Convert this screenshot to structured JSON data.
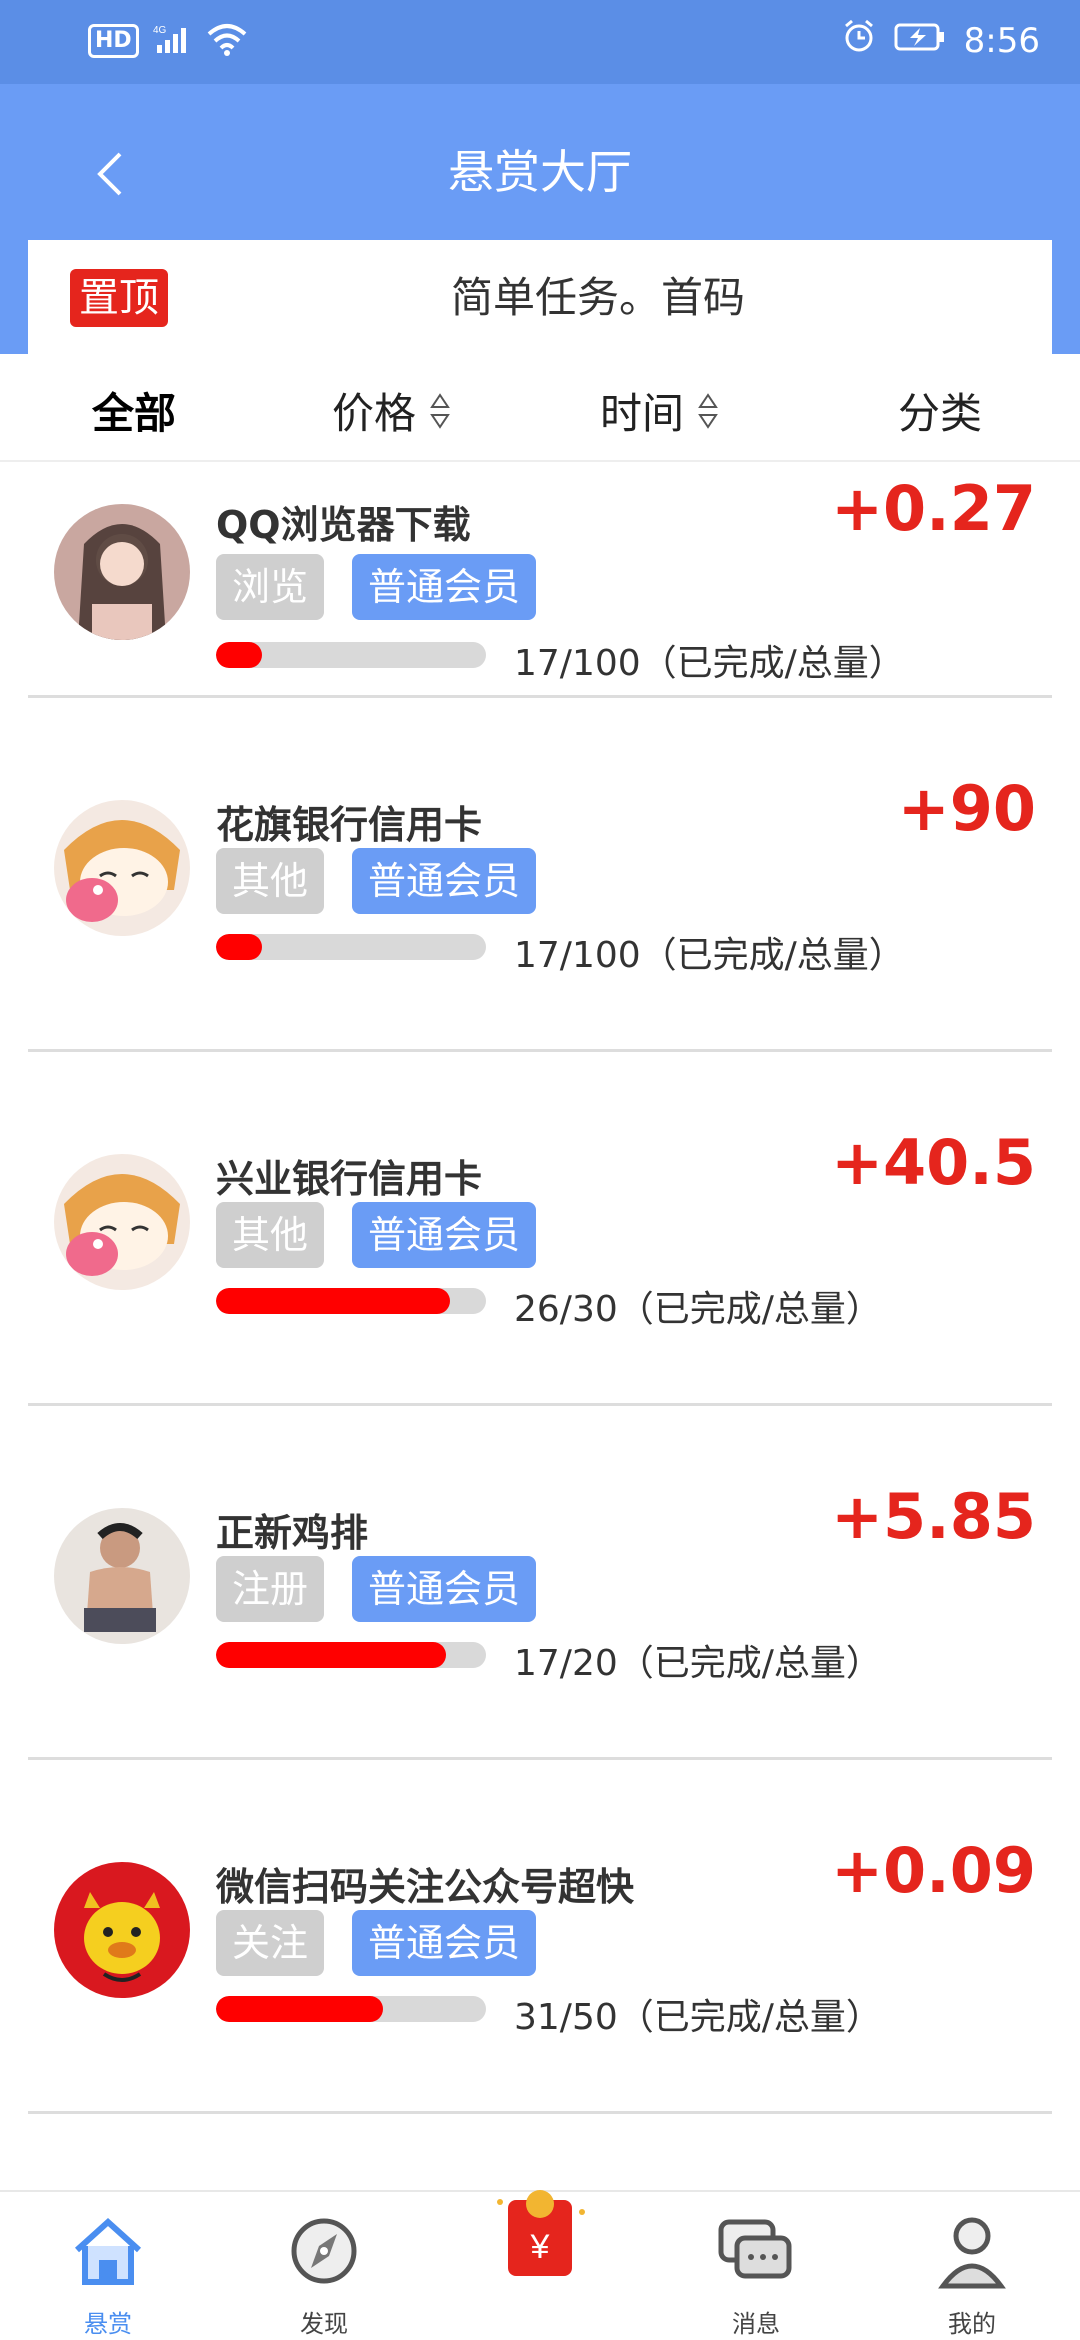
{
  "status_bar": {
    "network": "HD",
    "signal": "4G",
    "time": "8:56"
  },
  "header": {
    "title": "悬赏大厅",
    "back_icon": "chevron-left-icon"
  },
  "banner": {
    "pin_label": "置顶",
    "text": "简单任务。首码"
  },
  "filters": [
    {
      "label": "全部",
      "active": true
    },
    {
      "label": "价格",
      "sortable": true
    },
    {
      "label": "时间",
      "sortable": true
    },
    {
      "label": "分类"
    }
  ],
  "tasks": [
    {
      "title": "QQ浏览器下载",
      "reward": "+0.27",
      "category": "浏览",
      "member": "普通会员",
      "progress_text": "17/100（已完成/总量）",
      "progress": 0.17
    },
    {
      "title": "花旗银行信用卡",
      "reward": "+90",
      "category": "其他",
      "member": "普通会员",
      "progress_text": "17/100（已完成/总量）",
      "progress": 0.17
    },
    {
      "title": "兴业银行信用卡",
      "reward": "+40.5",
      "category": "其他",
      "member": "普通会员",
      "progress_text": "26/30（已完成/总量）",
      "progress": 0.867
    },
    {
      "title": "正新鸡排",
      "reward": "+5.85",
      "category": "注册",
      "member": "普通会员",
      "progress_text": "17/20（已完成/总量）",
      "progress": 0.85
    },
    {
      "title": "微信扫码关注公众号超快",
      "reward": "+0.09",
      "category": "关注",
      "member": "普通会员",
      "progress_text": "31/50（已完成/总量）",
      "progress": 0.62
    }
  ],
  "tabbar": [
    {
      "label": "悬赏",
      "icon": "home-icon",
      "active": true
    },
    {
      "label": "发现",
      "icon": "discover-icon"
    },
    {
      "label": "",
      "icon": "red-envelope-icon"
    },
    {
      "label": "消息",
      "icon": "message-icon"
    },
    {
      "label": "我的",
      "icon": "profile-icon"
    }
  ],
  "colors": {
    "primary": "#6a9cf5",
    "status_bar": "#5b8ee6",
    "reward_red": "#e5251d",
    "progress_red": "#ff0000"
  }
}
